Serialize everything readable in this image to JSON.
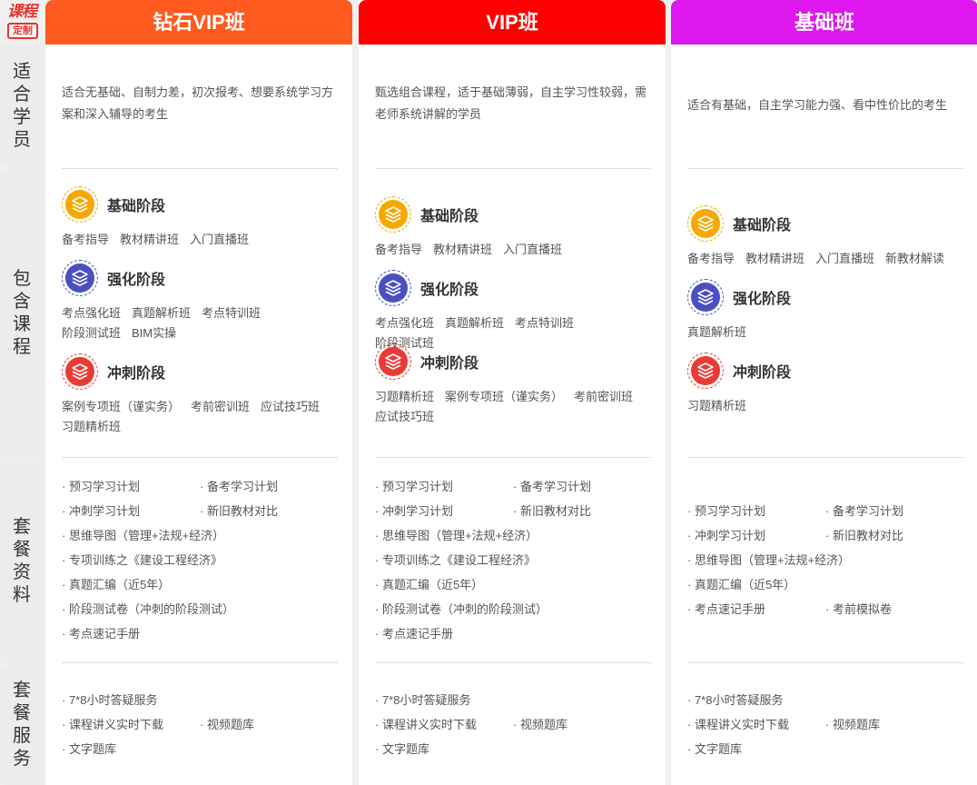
{
  "logo": {
    "line1": "课程",
    "line2": "定制"
  },
  "row_labels": [
    "适合学员",
    "包含课程",
    "套餐资料",
    "套餐服务"
  ],
  "colors": {
    "diamond": "#ff5a1f",
    "vip": "#ff0000",
    "basic": "#dd17ee",
    "stage_basic": "#f7a800",
    "stage_strengthen": "#4a4fc2",
    "stage_sprint": "#ea3a34"
  },
  "columns": [
    {
      "title": "钻石VIP班",
      "suitable": "适合无基础、自制力差，初次报考、想要系统学习方案和深入辅导的考生",
      "stages": [
        {
          "title": "基础阶段",
          "icon": "layers-icon",
          "items": [
            "备考指导",
            "教材精讲班",
            "入门直播班"
          ]
        },
        {
          "title": "强化阶段",
          "icon": "layers-icon",
          "items": [
            "考点强化班",
            "真题解析班",
            "考点特训班",
            "阶段测试班",
            "BIM实操"
          ]
        },
        {
          "title": "冲刺阶段",
          "icon": "layers-icon",
          "items": [
            "案例专项班（谨实务）",
            "考前密训班",
            "应试技巧班",
            "习题精析班"
          ]
        }
      ],
      "materials": [
        [
          "· 预习学习计划",
          "· 备考学习计划"
        ],
        [
          "· 冲刺学习计划",
          "· 新旧教材对比"
        ],
        [
          "· 思维导图（管理+法规+经济）"
        ],
        [
          "· 专项训练之《建设工程经济》"
        ],
        [
          "· 真题汇编（近5年）"
        ],
        [
          "· 阶段测试卷（冲刺的阶段测试）"
        ],
        [
          "· 考点速记手册"
        ]
      ],
      "services": [
        [
          "· 7*8小时答疑服务"
        ],
        [
          "· 课程讲义实时下载",
          "· 视频题库"
        ],
        [
          "· 文字题库"
        ]
      ]
    },
    {
      "title": "VIP班",
      "suitable": "甄选组合课程，适于基础薄弱，自主学习性较弱，需老师系统讲解的学员",
      "stages": [
        {
          "title": "基础阶段",
          "icon": "layers-icon",
          "items": [
            "备考指导",
            "教材精讲班",
            "入门直播班"
          ]
        },
        {
          "title": "强化阶段",
          "icon": "layers-icon",
          "items": [
            "考点强化班",
            "真题解析班",
            "考点特训班",
            "阶段测试班"
          ]
        },
        {
          "title": "冲刺阶段",
          "icon": "layers-icon",
          "items": [
            "习题精析班",
            "案例专项班（谨实务）",
            "考前密训班",
            "应试技巧班"
          ]
        }
      ],
      "materials": [
        [
          "· 预习学习计划",
          "· 备考学习计划"
        ],
        [
          "· 冲刺学习计划",
          "· 新旧教材对比"
        ],
        [
          "· 思维导图（管理+法规+经济）"
        ],
        [
          "· 专项训练之《建设工程经济》"
        ],
        [
          "· 真题汇编（近5年）"
        ],
        [
          "· 阶段测试卷（冲刺的阶段测试）"
        ],
        [
          "· 考点速记手册"
        ]
      ],
      "services": [
        [
          "· 7*8小时答疑服务"
        ],
        [
          "· 课程讲义实时下载",
          "· 视频题库"
        ],
        [
          "· 文字题库"
        ]
      ]
    },
    {
      "title": "基础班",
      "suitable": "适合有基础，自主学习能力强、看中性价比的考生",
      "stages": [
        {
          "title": "基础阶段",
          "icon": "layers-icon",
          "items": [
            "备考指导",
            "教材精讲班",
            "入门直播班",
            "新教材解读"
          ]
        },
        {
          "title": "强化阶段",
          "icon": "layers-icon",
          "items": [
            "真题解析班"
          ]
        },
        {
          "title": "冲刺阶段",
          "icon": "layers-icon",
          "items": [
            "习题精析班"
          ]
        }
      ],
      "materials": [
        [
          "· 预习学习计划",
          "· 备考学习计划"
        ],
        [
          "· 冲刺学习计划",
          "· 新旧教材对比"
        ],
        [
          "· 思维导图（管理+法规+经济）"
        ],
        [
          "· 真题汇编（近5年）"
        ],
        [
          "· 考点速记手册",
          "· 考前模拟卷"
        ]
      ],
      "services": [
        [
          "· 7*8小时答疑服务"
        ],
        [
          "· 课程讲义实时下载",
          "· 视频题库"
        ],
        [
          "· 文字题库"
        ]
      ]
    }
  ]
}
